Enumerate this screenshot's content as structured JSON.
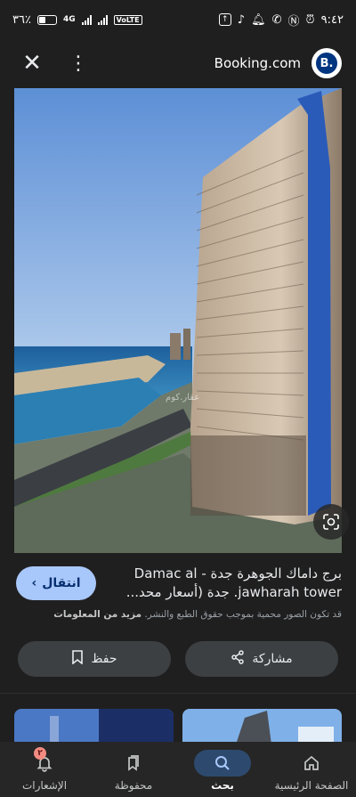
{
  "status_bar": {
    "battery": "٣٦٪",
    "network": "4G",
    "volte": "VoLTE",
    "time": "٩:٤٢"
  },
  "header": {
    "site_name": "Booking.com",
    "logo_letter": "B."
  },
  "image": {
    "watermark": "عقار.كوم"
  },
  "result": {
    "title_line1": "برج داماك الجوهرة جدة - Damac al",
    "title_line2": "jawharah tower. جدة (أسعار محد...",
    "visit_label": "انتقال",
    "copyright_text": "قد تكون الصور محمية بموجب حقوق الطبع والنشر.",
    "more_info_label": "مزيد من المعلومات",
    "save_label": "حفظ",
    "share_label": "مشاركة"
  },
  "nav": {
    "items": [
      {
        "label": "الصفحة الرئيسية",
        "icon": "home-icon"
      },
      {
        "label": "بحث",
        "icon": "search-icon"
      },
      {
        "label": "محفوظة",
        "icon": "bookmarks-icon"
      },
      {
        "label": "الإشعارات",
        "icon": "bell-icon",
        "badge": "٢"
      }
    ],
    "active_index": 1
  },
  "colors": {
    "accent": "#a8c7fa",
    "background": "#1f1f1f",
    "button_bg": "#3c4043"
  }
}
